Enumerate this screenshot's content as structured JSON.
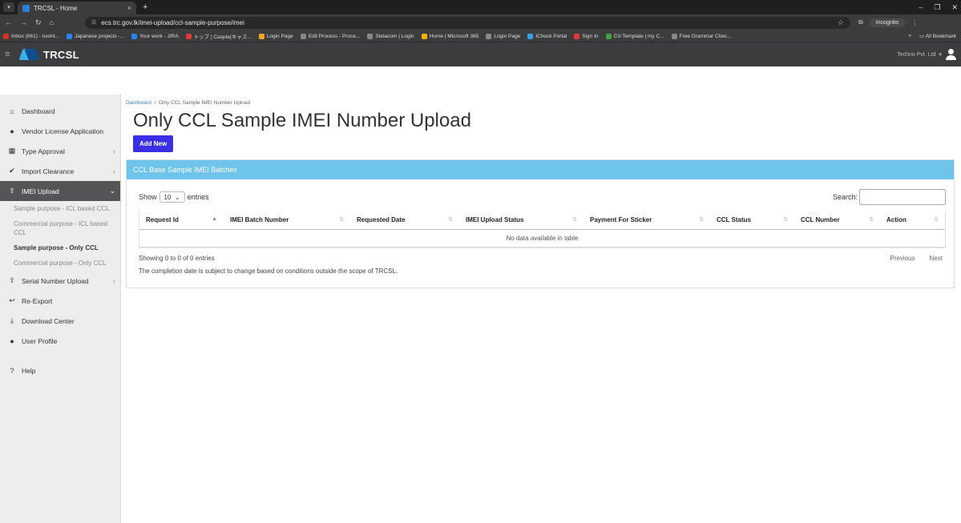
{
  "browser": {
    "tab_title": "TRCSL - Home",
    "tab_close": "×",
    "new_tab": "+",
    "url": "ecs.trc.gov.lk/imei-upload/ccl-sample-purpose/imei",
    "incognito_label": "Incognito",
    "bookmarks": [
      {
        "label": "Inbox (661) - ruvint...",
        "color": "#d93025"
      },
      {
        "label": "Japanese projects -...",
        "color": "#2684ff"
      },
      {
        "label": "Your work - JIRA",
        "color": "#2684ff"
      },
      {
        "label": "トップ | Caspla(キャス...",
        "color": "#e53935"
      },
      {
        "label": "Login Page",
        "color": "#f5a623"
      },
      {
        "label": "Edit Process - Proce...",
        "color": "#888888"
      },
      {
        "label": "Stelacom | Login",
        "color": "#888888"
      },
      {
        "label": "Home | Microsoft 365",
        "color": "#f4b400"
      },
      {
        "label": "Login Page",
        "color": "#888888"
      },
      {
        "label": "ICheck Portal",
        "color": "#3aa0e0"
      },
      {
        "label": "Sign In",
        "color": "#e53935"
      },
      {
        "label": "CV-Template | my C...",
        "color": "#43a047"
      },
      {
        "label": "Free Grammar Chec...",
        "color": "#888888"
      }
    ],
    "all_bookmarks": "All Bookmark"
  },
  "header": {
    "brand": "TRCSL",
    "user": "Techno Pvt. Ltd"
  },
  "sidebar": {
    "items": [
      {
        "label": "Dashboard",
        "icon": "home-icon"
      },
      {
        "label": "Vendor License Application",
        "icon": "user-icon"
      },
      {
        "label": "Type Approval",
        "icon": "table-icon"
      },
      {
        "label": "Import Clearance",
        "icon": "check-circle-icon"
      },
      {
        "label": "IMEI Upload",
        "icon": "user-upload-icon"
      },
      {
        "label": "Serial Number Upload",
        "icon": "user-upload-icon"
      },
      {
        "label": "Re-Export",
        "icon": "reply-icon"
      },
      {
        "label": "Download Center",
        "icon": "download-icon"
      },
      {
        "label": "User Profile",
        "icon": "user-icon"
      },
      {
        "label": "Help",
        "icon": "question-circle-icon"
      }
    ],
    "imei_sub": [
      {
        "label": "Sample purpose - ICL based CCL"
      },
      {
        "label": "Commercial purpose - ICL based CCL"
      },
      {
        "label": "Sample purpose - Only CCL"
      },
      {
        "label": "Commercial purpose - Only CCL"
      }
    ]
  },
  "breadcrumb": {
    "home": "Dashboard",
    "separator": "/",
    "current": "Only CCL Sample IMEI Number Upload"
  },
  "page": {
    "title": "Only CCL Sample IMEI Number Upload",
    "add_button": "Add New"
  },
  "card": {
    "title": "CCL Base Sample IMEI Batches"
  },
  "datatable": {
    "show_label": "Show",
    "entries_label": "entries",
    "page_size": "10",
    "search_label": "Search:",
    "columns": [
      "Request Id",
      "IMEI Batch Number",
      "Requested Date",
      "IMEI Upload Status",
      "Payment For Sticker",
      "CCL Status",
      "CCL Number",
      "Action"
    ],
    "empty_message": "No data available in table",
    "info": "Showing 0 to 0 of 0 entries",
    "previous": "Previous",
    "next": "Next"
  },
  "note": "The completion date is subject to change based on conditions outside the scope of TRCSL."
}
